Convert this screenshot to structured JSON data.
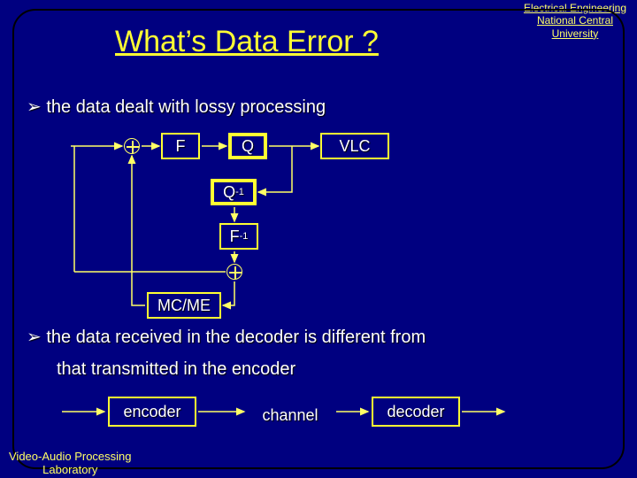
{
  "affiliation": {
    "line1": "Electrical Engineering",
    "line2": "National Central",
    "line3": "University"
  },
  "title": "What’s Data Error ?",
  "bullets": {
    "b1": "the data dealt with lossy processing",
    "b2": "the data received in the decoder is different from",
    "b2_cont": "that transmitted in the encoder"
  },
  "diagram": {
    "F": "F",
    "Q": "Q",
    "VLC": "VLC",
    "Qinv_base": "Q",
    "Qinv_sup": "-1",
    "Finv_base": "F",
    "Finv_sup": "-1",
    "MCME": "MC/ME"
  },
  "row2": {
    "encoder": "encoder",
    "channel": "channel",
    "decoder": "decoder"
  },
  "footer": {
    "line1": "Video-Audio Processing",
    "line2": "Laboratory"
  },
  "bullet_glyph": "➢"
}
